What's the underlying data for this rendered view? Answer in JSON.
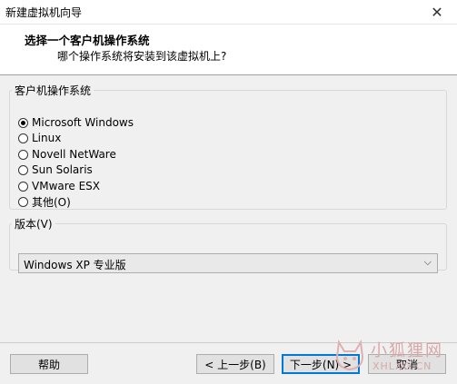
{
  "window": {
    "title": "新建虚拟机向导",
    "close_glyph": "✕"
  },
  "header": {
    "heading": "选择一个客户机操作系统",
    "subheading": "哪个操作系统将安装到该虚拟机上?"
  },
  "os_group": {
    "legend": "客户机操作系统",
    "options": [
      {
        "label": "Microsoft Windows",
        "checked": true
      },
      {
        "label": "Linux",
        "checked": false
      },
      {
        "label": "Novell NetWare",
        "checked": false
      },
      {
        "label": "Sun Solaris",
        "checked": false
      },
      {
        "label": "VMware ESX",
        "checked": false
      },
      {
        "label": "其他(O)",
        "checked": false
      }
    ]
  },
  "version_group": {
    "legend": "版本(V)",
    "selected": "Windows XP 专业版",
    "chevron": "⌵"
  },
  "buttons": {
    "help": "帮助",
    "back": "< 上一步(B)",
    "next": "下一步(N) >",
    "cancel": "取消"
  },
  "watermark": {
    "text_cn": "小狐狸网",
    "text_en": "XHLXG.CN"
  },
  "colors": {
    "accent": "#0078d7",
    "watermark": "#d8a8a8"
  }
}
